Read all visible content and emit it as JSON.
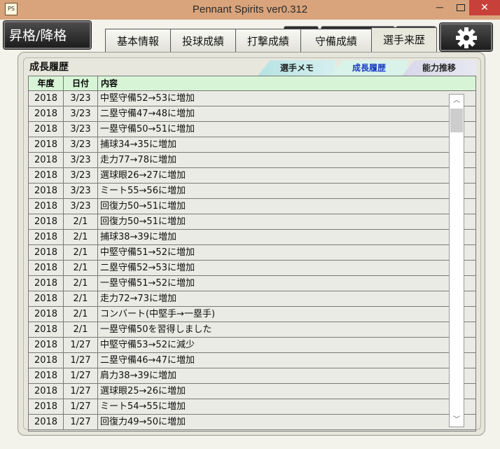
{
  "window": {
    "title": "Pennant Spirits ver0.312",
    "minimize_glyph": "─",
    "close_glyph": "✕"
  },
  "toolbar": {
    "promote_label": "昇格/降格",
    "settings_icon": "gear-icon"
  },
  "tabs": [
    {
      "label": "基本情報"
    },
    {
      "label": "投球成績"
    },
    {
      "label": "打撃成績"
    },
    {
      "label": "守備成績"
    },
    {
      "label": "選手来歴",
      "active": true
    }
  ],
  "section": {
    "title": "成長履歴",
    "subtabs": [
      {
        "label": "選手メモ"
      },
      {
        "label": "成長履歴",
        "active": true
      },
      {
        "label": "能力推移"
      }
    ]
  },
  "table": {
    "headers": {
      "year": "年度",
      "date": "日付",
      "content": "内容"
    },
    "rows": [
      {
        "year": "2018",
        "date": "3/23",
        "text": "中堅守備52→53に増加"
      },
      {
        "year": "2018",
        "date": "3/23",
        "text": "二塁守備47→48に増加"
      },
      {
        "year": "2018",
        "date": "3/23",
        "text": "一塁守備50→51に増加"
      },
      {
        "year": "2018",
        "date": "3/23",
        "text": "捕球34→35に増加"
      },
      {
        "year": "2018",
        "date": "3/23",
        "text": "走力77→78に増加"
      },
      {
        "year": "2018",
        "date": "3/23",
        "text": "選球眼26→27に増加"
      },
      {
        "year": "2018",
        "date": "3/23",
        "text": "ミート55→56に増加"
      },
      {
        "year": "2018",
        "date": "3/23",
        "text": "回復力50→51に増加"
      },
      {
        "year": "2018",
        "date": "2/1",
        "text": "回復力50→51に増加"
      },
      {
        "year": "2018",
        "date": "2/1",
        "text": "捕球38→39に増加"
      },
      {
        "year": "2018",
        "date": "2/1",
        "text": "中堅守備51→52に増加"
      },
      {
        "year": "2018",
        "date": "2/1",
        "text": "二塁守備52→53に増加"
      },
      {
        "year": "2018",
        "date": "2/1",
        "text": "一塁守備51→52に増加"
      },
      {
        "year": "2018",
        "date": "2/1",
        "text": "走力72→73に増加"
      },
      {
        "year": "2018",
        "date": "2/1",
        "text": "コンバート(中堅手→一塁手)"
      },
      {
        "year": "2018",
        "date": "2/1",
        "text": "一塁守備50を習得しました"
      },
      {
        "year": "2018",
        "date": "1/27",
        "text": "中堅守備53→52に減少"
      },
      {
        "year": "2018",
        "date": "1/27",
        "text": "二塁守備46→47に増加"
      },
      {
        "year": "2018",
        "date": "1/27",
        "text": "肩力38→39に増加"
      },
      {
        "year": "2018",
        "date": "1/27",
        "text": "選球眼25→26に増加"
      },
      {
        "year": "2018",
        "date": "1/27",
        "text": "ミート54→55に増加"
      },
      {
        "year": "2018",
        "date": "1/27",
        "text": "回復力49→50に増加"
      }
    ]
  },
  "scrollbar": {
    "up_glyph": "︿",
    "down_glyph": "﹀"
  }
}
